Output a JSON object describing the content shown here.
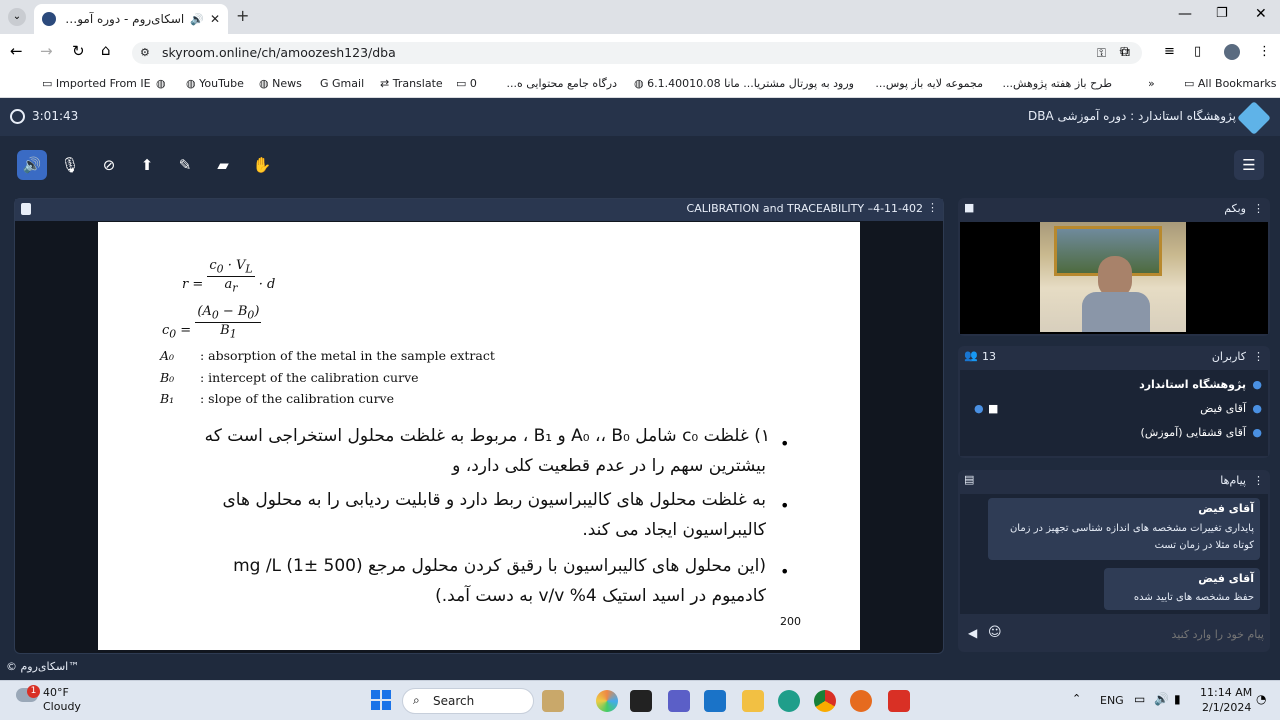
{
  "browser": {
    "tab_title": "اسکای‌روم - دوره آموزشی DBA",
    "url": "skyroom.online/ch/amoozesh123/dba",
    "bookmarks": [
      "Imported From IE",
      "YouTube",
      "News",
      "Gmail",
      "Translate",
      "0",
      "درگاه جامع محتوایی ه...",
      "6.1.40010.08 مانا",
      "ورود به پورتال مشتریا...",
      "مجموعه لایه باز پوس...",
      "طرح باز هفته پژوهش..."
    ],
    "all_bookmarks": "All Bookmarks"
  },
  "app": {
    "timer": "3:01:43",
    "room_title": "پژوهشگاه استاندارد : دوره آموزشی DBA",
    "copyright": "™اسکای‌روم ©"
  },
  "slide": {
    "header": "CALIBRATION and TRACEABILITY –4-11-402",
    "defs": [
      {
        "sym": "A₀",
        "text": ": absorption of the metal in the sample extract"
      },
      {
        "sym": "B₀",
        "text": ": intercept of the calibration curve"
      },
      {
        "sym": "B₁",
        "text": ": slope of the calibration curve"
      }
    ],
    "bullet1_line1": "۱) غلظت c₀ شامل A₀ ،، B₀ و B₁ ، مربوط به غلظت محلول استخراجی است که",
    "bullet1_line2": "بیشترین سهم را در عدم قطعیت کلی دارد، و",
    "bullet2_line1": "به غلظت محلول های کالیبراسیون ربط دارد و قابلیت ردیابی را به محلول های",
    "bullet2_line2": "کالیبراسیون ایجاد می کند.",
    "bullet3_line1": "(این محلول های کالیبراسیون با رقیق کردن محلول مرجع mg /L (1± 500)",
    "bullet3_line2": "کادمیوم در اسید استیک 4% v/v به دست آمد.)",
    "page_no": "200"
  },
  "webcam": {
    "title": "وبکم"
  },
  "users": {
    "title": "کاربران",
    "count": "13",
    "list": [
      "پژوهشگاه استاندارد",
      "آقای فیض",
      "آقای قشقایی (آموزش)"
    ]
  },
  "messages": {
    "title": "پیام‌ها",
    "items": [
      {
        "sender": "آقای فیض",
        "text": "پایداری تغییرات مشخصه های اندازه شناسی تجهیز در زمان کوتاه مثلا در زمان تست"
      },
      {
        "sender": "آقای فیض",
        "text": "حفظ مشخصه های تایید شده"
      }
    ],
    "input_placeholder": "پیام خود را وارد کنید"
  },
  "taskbar": {
    "weather_temp": "40°F",
    "weather_desc": "Cloudy",
    "search": "Search",
    "lang": "ENG",
    "time": "11:14 AM",
    "date": "2/1/2024",
    "badge": "1"
  },
  "colors": {
    "accent": "#4a90e2",
    "red_text": "#b22222",
    "app_bg": "#1f2a3d"
  }
}
